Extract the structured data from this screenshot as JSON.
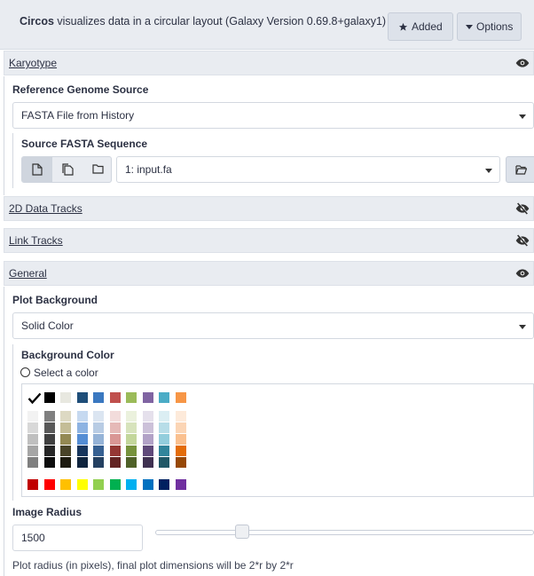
{
  "header": {
    "tool_name": "Circos",
    "tool_description": " visualizes data in a circular layout (Galaxy Version 0.69.8+galaxy1)",
    "added_label": "Added",
    "options_label": "Options"
  },
  "sections": {
    "karyotype": "Karyotype",
    "data_tracks_2d": "2D Data Tracks",
    "link_tracks": "Link Tracks",
    "general": "General"
  },
  "karyotype": {
    "reference_title": "Reference Genome Source",
    "reference_value": "FASTA File from History",
    "source_title": "Source FASTA Sequence",
    "source_value": "1: input.fa"
  },
  "general": {
    "plot_background_title": "Plot Background",
    "plot_background_value": "Solid Color",
    "background_color_title": "Background Color",
    "select_color_label": "Select a color",
    "image_radius_title": "Image Radius",
    "image_radius_value": "1500",
    "image_radius_slider": 0.22,
    "help_text": "Plot radius (in pixels), final plot dimensions will be 2*r by 2*r"
  },
  "palette": {
    "top_row": [
      "#000000",
      "#e8e8e0",
      "#1f4e79",
      "#3a78c0",
      "#c0504d",
      "#9bbb59",
      "#8064a2",
      "#4bacc6",
      "#f79646"
    ],
    "shade_columns": [
      [
        "#f2f2f2",
        "#d8d8d8",
        "#bfbfbf",
        "#a5a5a5",
        "#7f7f7f"
      ],
      [
        "#7f7f7f",
        "#595959",
        "#404040",
        "#262626",
        "#0d0d0d"
      ],
      [
        "#ddd9c3",
        "#c4bd97",
        "#938953",
        "#494429",
        "#1d1b10"
      ],
      [
        "#c6d9f0",
        "#8db3e2",
        "#548dd4",
        "#17365d",
        "#0f243e"
      ],
      [
        "#dbe5f1",
        "#b8cce4",
        "#95b3d7",
        "#366092",
        "#244061"
      ],
      [
        "#f2dcdb",
        "#e5b9b7",
        "#d99694",
        "#953734",
        "#632423"
      ],
      [
        "#ebf1dd",
        "#d7e3bc",
        "#c3d69b",
        "#76923c",
        "#4f6128"
      ],
      [
        "#e5e0ec",
        "#ccc1d9",
        "#b2a2c7",
        "#5f497a",
        "#3f3151"
      ],
      [
        "#dbeef3",
        "#b7dde8",
        "#92cddc",
        "#31859b",
        "#205867"
      ],
      [
        "#fdeada",
        "#fbd5b5",
        "#fac08f",
        "#e36c09",
        "#974806"
      ]
    ],
    "bottom_row": [
      "#c00000",
      "#ff0000",
      "#ffc000",
      "#ffff00",
      "#92d050",
      "#00b050",
      "#00b0f0",
      "#0070c0",
      "#002060",
      "#7030a0"
    ]
  },
  "icons": {
    "visible": "eye-icon",
    "hidden": "eye-slash-icon",
    "added": "star-icon",
    "options": "caret-down-icon",
    "single_dataset": "file-icon",
    "multiple_datasets": "files-icon",
    "collection": "folder-icon",
    "browse": "folder-open-icon",
    "selected_color": "checkmark-icon"
  },
  "colors": {
    "header_bg": "#e9ecf1",
    "text": "#2c3143"
  }
}
